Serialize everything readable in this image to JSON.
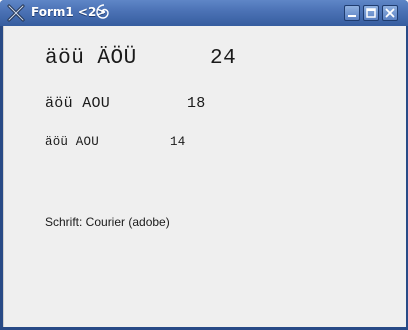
{
  "window": {
    "title": "Form1 <2>",
    "accent": "#4c73b6",
    "client_background": "#efefef"
  },
  "titlebar_buttons": {
    "minimize_icon": "minimize-icon",
    "maximize_icon": "maximize-icon",
    "close_icon": "close-icon"
  },
  "samples": [
    {
      "text": "äöü ÄÖÜ",
      "size": "24"
    },
    {
      "text": "äöü AOU",
      "size": "18"
    },
    {
      "text": "äöü AOU",
      "size": "14"
    }
  ],
  "font_info": "Schrift: Courier (adobe)"
}
